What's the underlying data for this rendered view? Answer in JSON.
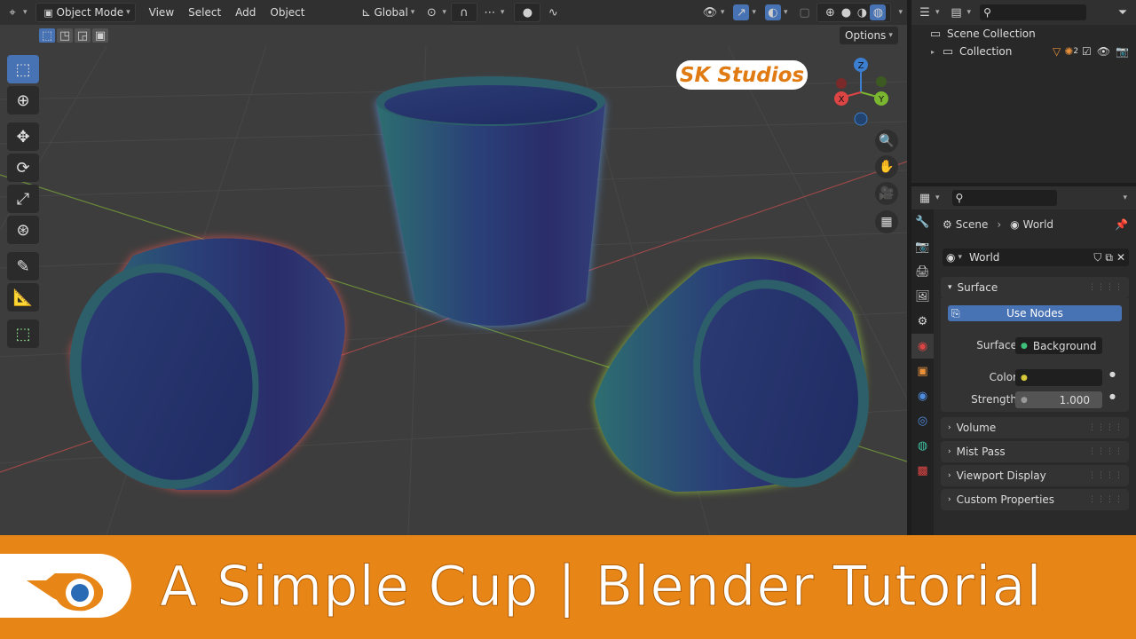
{
  "header": {
    "mode_label": "Object Mode",
    "menus": [
      "View",
      "Select",
      "Add",
      "Object"
    ],
    "orientation_label": "Global",
    "options_label": "Options"
  },
  "viewport": {
    "watermark": "SK Studios",
    "gizmo": {
      "z": "Z",
      "y": "Y",
      "x": "X"
    },
    "tools": [
      "select-box-icon",
      "cursor-icon",
      "move-icon",
      "rotate-icon",
      "scale-icon",
      "transform-icon",
      "annotate-icon",
      "measure-icon",
      "add-cube-icon"
    ],
    "nav": [
      "zoom-icon",
      "hand-pan-icon",
      "camera-icon",
      "grid-ortho-icon"
    ]
  },
  "outliner": {
    "root": "Scene Collection",
    "child": "Collection",
    "child_count": "2"
  },
  "properties": {
    "breadcrumb_scene": "Scene",
    "breadcrumb_world": "World",
    "world_name": "World",
    "surface_panel": "Surface",
    "use_nodes_label": "Use Nodes",
    "surface_label": "Surface",
    "surface_value": "Background",
    "color_label": "Color",
    "strength_label": "Strength",
    "strength_value": "1.000",
    "collapsed_panels": [
      "Volume",
      "Mist Pass",
      "Viewport Display",
      "Custom Properties"
    ]
  },
  "banner": {
    "title": "A Simple Cup | Blender Tutorial"
  },
  "colors": {
    "accent_blue": "#4772b3",
    "banner_orange": "#e78517",
    "watermark_orange": "#e07a12"
  }
}
